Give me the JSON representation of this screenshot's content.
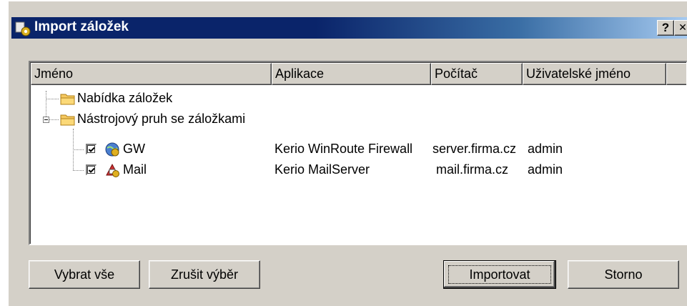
{
  "window": {
    "title": "Import záložek",
    "help_label": "?",
    "close_label": "✕",
    "title_icon": "import-gear-icon"
  },
  "list": {
    "columns": [
      "Jméno",
      "Aplikace",
      "Počítač",
      "Uživatelské jméno"
    ],
    "rows": [
      {
        "name": "Nabídka záložek",
        "type": "folder",
        "expanded": null,
        "application": "",
        "computer": "",
        "username": ""
      },
      {
        "name": "Nástrojový pruh se záložkami",
        "type": "folder",
        "expanded": true,
        "application": "",
        "computer": "",
        "username": ""
      },
      {
        "name": "GW",
        "type": "bookmark",
        "checked": true,
        "icon": "winroute-globe-icon",
        "application": "Kerio WinRoute Firewall",
        "computer": "server.firma.cz",
        "username": "admin"
      },
      {
        "name": "Mail",
        "type": "bookmark",
        "checked": true,
        "icon": "mailserver-icon",
        "application": "Kerio MailServer",
        "computer": "mail.firma.cz",
        "username": "admin"
      }
    ]
  },
  "buttons": {
    "select_all": "Vybrat vše",
    "deselect": "Zrušit výběr",
    "import": "Importovat",
    "cancel": "Storno"
  },
  "colors": {
    "titlebar_start": "#0a246a",
    "titlebar_end": "#a6caf0",
    "face": "#d4d0c8",
    "folder": "#f5c860"
  }
}
